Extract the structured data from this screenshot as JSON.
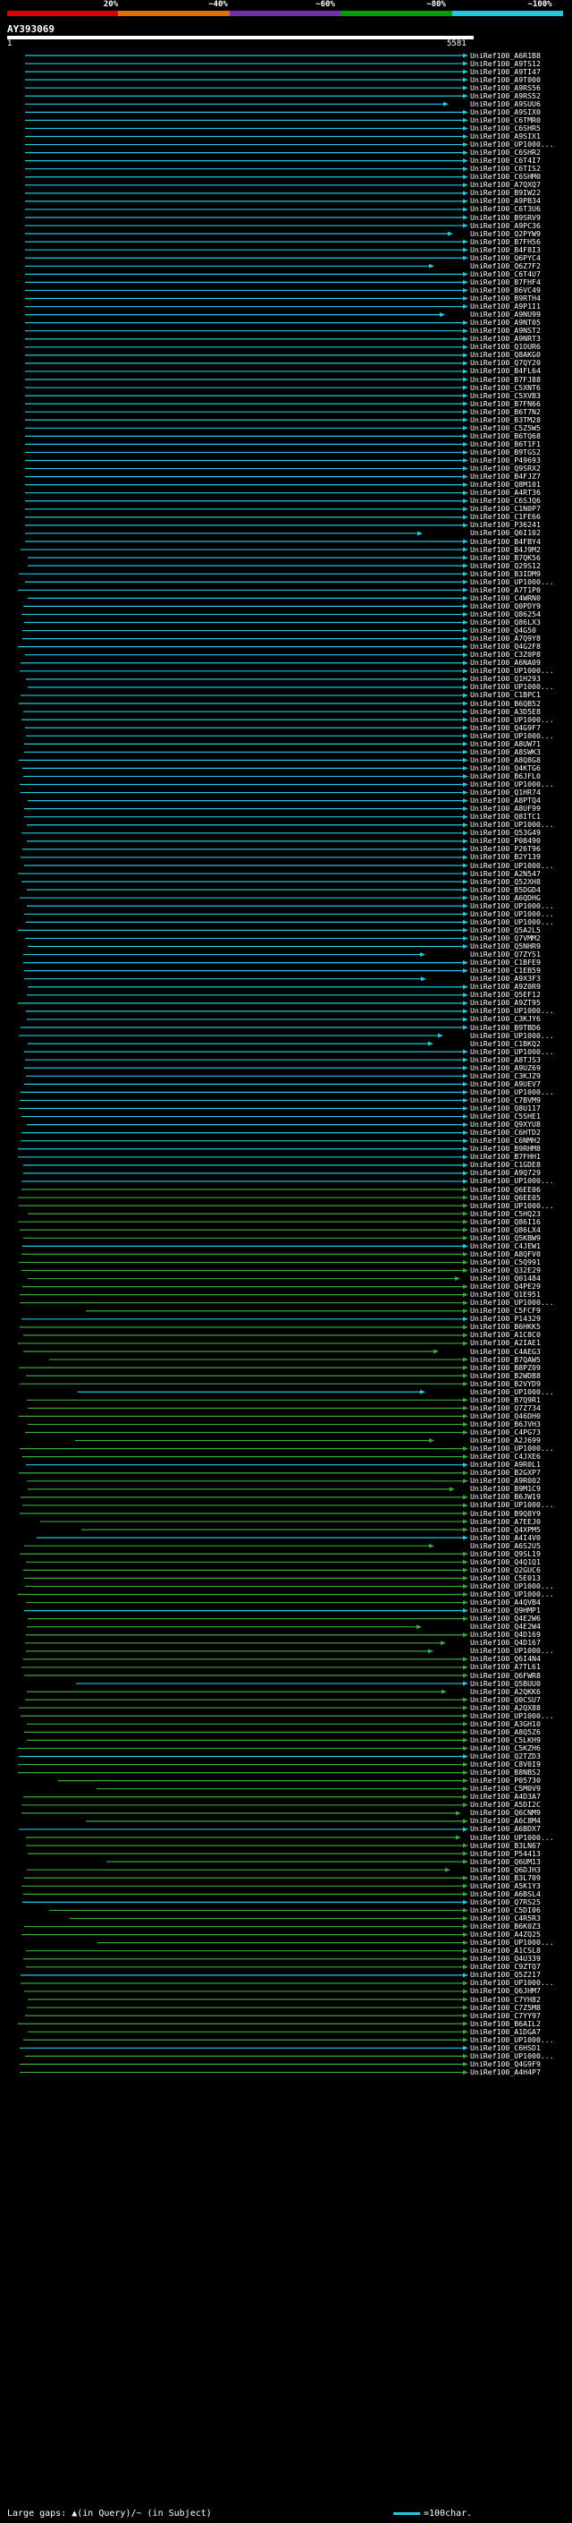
{
  "legend": {
    "labels": [
      "20%",
      "~40%",
      "~60%",
      "~80%",
      "~100%"
    ],
    "colors": [
      "#e00000",
      "#e07000",
      "#7030b0",
      "#00a000",
      "#22c8dc"
    ]
  },
  "query": {
    "name": "AY393069",
    "start": "1",
    "end": "5581"
  },
  "colors": {
    "cyan": "#22c8dc",
    "green": "#3aa83a",
    "blue": "#3c78ff",
    "white": "#ffffff"
  },
  "hits": [
    "UniRef100_A6R1B8",
    "UniRef100_A9TS12",
    "UniRef100_A9TI47",
    "UniRef100_A9T000",
    "UniRef100_A9RS56",
    "UniRef100_A9RS52",
    "UniRef100_A9SUU6",
    "UniRef100_A9SIX0",
    "UniRef100_C6TMR0",
    "UniRef100_C6SHR5",
    "UniRef100_A9SIX1",
    "UniRef100_UP1000...",
    "UniRef100_C6SHR2",
    "UniRef100_C6T4I7",
    "UniRef100_C6TIS2",
    "UniRef100_C6SHM0",
    "UniRef100_A7QXQ7",
    "UniRef100_B9IW22",
    "UniRef100_A9PB34",
    "UniRef100_C6T3U6",
    "UniRef100_B9SRV9",
    "UniRef100_A9PC36",
    "UniRef100_Q2PYW9",
    "UniRef100_B7FH56",
    "UniRef100_B4F8I3",
    "UniRef100_Q6PYC4",
    "UniRef100_Q6Z7F2",
    "UniRef100_C6T4U7",
    "UniRef100_B7FHF4",
    "UniRef100_B6VC49",
    "UniRef100_B9RTH4",
    "UniRef100_A9P1I1",
    "UniRef100_A9NU99",
    "UniRef100_A9NT05",
    "UniRef100_A9NST2",
    "UniRef100_A9NRT3",
    "UniRef100_Q1OUR6",
    "UniRef100_Q8AKG0",
    "UniRef100_Q7QY20",
    "UniRef100_B4FL64",
    "UniRef100_B7FJ88",
    "UniRef100_C5XNT6",
    "UniRef100_C5XVB3",
    "UniRef100_B7FN66",
    "UniRef100_B6T7N2",
    "UniRef100_B3TM28",
    "UniRef100_C5Z5W5",
    "UniRef100_B6TQ68",
    "UniRef100_B6T1F1",
    "UniRef100_B9TGS2",
    "UniRef100_P49693",
    "UniRef100_Q9SRX2",
    "UniRef100_B4FJZ7",
    "UniRef100_Q8M101",
    "UniRef100_A4RT36",
    "UniRef100_C6SJQ6",
    "UniRef100_C1N0P7",
    "UniRef100_C1FE66",
    "UniRef100_P36241",
    "UniRef100_Q6I102",
    "UniRef100_B4FBY4",
    "UniRef100_B4J9M2",
    "UniRef100_B7QK56",
    "UniRef100_Q29S12",
    "UniRef100_B3IDM9",
    "UniRef100_UP1000...",
    "UniRef100_A7T1P0",
    "UniRef100_C4WRN0",
    "UniRef100_Q0PDY9",
    "UniRef100_Q86254",
    "UniRef100_Q86LX3",
    "UniRef100_Q4G50",
    "UniRef100_A7Q9Y8",
    "UniRef100_Q4G2F8",
    "UniRef100_C3Z0P8",
    "UniRef100_A6NA09",
    "UniRef100_UP1000...",
    "UniRef100_Q1H293",
    "UniRef100_UP1000...",
    "UniRef100_C1BPC1",
    "UniRef100_B6QB52",
    "UniRef100_A3D5E8",
    "UniRef100_UP1000...",
    "UniRef100_Q4G9F7",
    "UniRef100_UP1000...",
    "UniRef100_A8UW71",
    "UniRef100_A8SWK3",
    "UniRef100_A8Q8G8",
    "UniRef100_Q4KTG6",
    "UniRef100_B6JFL0",
    "UniRef100_UP1000...",
    "UniRef100_Q1HR74",
    "UniRef100_A8PTQ4",
    "UniRef100_A8UF99",
    "UniRef100_Q8ITC1",
    "UniRef100_UP1000...",
    "UniRef100_Q53G49",
    "UniRef100_P08490",
    "UniRef100_P26T96",
    "UniRef100_B2Y139",
    "UniRef100_UP1000...",
    "UniRef100_A2N547",
    "UniRef100_Q52XH8",
    "UniRef100_B5DGD4",
    "UniRef100_A6QDHG",
    "UniRef100_UP1000...",
    "UniRef100_UP1000...",
    "UniRef100_UP1000...",
    "UniRef100_Q5A2L5",
    "UniRef100_Q7VMM2",
    "UniRef100_Q5NHR9",
    "UniRef100_Q7ZYS1",
    "UniRef100_C1BFE9",
    "UniRef100_C1EB59",
    "UniRef100_A9X3F3",
    "UniRef100_A9Z0R9",
    "UniRef100_Q5EF12",
    "UniRef100_A9ZT95",
    "UniRef100_UP1000...",
    "UniRef100_C3KJY6",
    "UniRef100_B9TBD6",
    "UniRef100_UP1000...",
    "UniRef100_C1BKQ2",
    "UniRef100_UP1000...",
    "UniRef100_A8TJS3",
    "UniRef100_A9UZ69",
    "UniRef100_C3KJZ9",
    "UniRef100_A9UEV7",
    "UniRef100_UP1000...",
    "UniRef100_C7BVM9",
    "UniRef100_Q8U117",
    "UniRef100_C5SHE1",
    "UniRef100_Q9XYU8",
    "UniRef100_C6HTD2",
    "UniRef100_C6NMH2",
    "UniRef100_B9RHM8",
    "UniRef100_B7FHH1",
    "UniRef100_C1GDE8",
    "UniRef100_A9Q729",
    "UniRef100_UP1000...",
    "UniRef100_Q6EE06",
    "UniRef100_Q6EE05",
    "UniRef100_UP1000...",
    "UniRef100_C5HQ23",
    "UniRef100_Q86I16",
    "UniRef100_Q86LX4",
    "UniRef100_Q5KBW9",
    "UniRef100_C4JEW1",
    "UniRef100_A8QFV0",
    "UniRef100_C5Q991",
    "UniRef100_Q32E29",
    "UniRef100_Q01484",
    "UniRef100_Q4PE29",
    "UniRef100_Q1E951",
    "UniRef100_UP1000...",
    "UniRef100_C5FCF9",
    "UniRef100_P14329",
    "UniRef100_B6HKK5",
    "UniRef100_A1C8C0",
    "UniRef100_A2IAE1",
    "UniRef100_C4AEG3",
    "UniRef100_B7QAW5",
    "UniRef100_B8PZ09",
    "UniRef100_B2WDB8",
    "UniRef100_B2VYD9",
    "UniRef100_UP1000...",
    "UniRef100_B7Q9R1",
    "UniRef100_Q7Z734",
    "UniRef100_Q46DH0",
    "UniRef100_B6JVH3",
    "UniRef100_C4PG73",
    "UniRef100_A2J699",
    "UniRef100_UP1000...",
    "UniRef100_C4JXE6",
    "UniRef100_A9R0L1",
    "UniRef100_B2GXP7",
    "UniRef100_A9R002",
    "UniRef100_B9M1C9",
    "UniRef100_B6JW19",
    "UniRef100_UP1000...",
    "UniRef100_B9Q8Y9",
    "UniRef100_A7EEJ0",
    "UniRef100_Q4XPM5",
    "UniRef100_A4I4V0",
    "UniRef100_A6S2U5",
    "UniRef100_Q9SL19",
    "UniRef100_Q4Q1Q1",
    "UniRef100_Q2GUC6",
    "UniRef100_C5E013",
    "UniRef100_UP1000...",
    "UniRef100_UP1000...",
    "UniRef100_A4QVB4",
    "UniRef100_Q9HMP1",
    "UniRef100_Q4E2W6",
    "UniRef100_Q4E2W4",
    "UniRef100_Q4D169",
    "UniRef100_Q4D167",
    "UniRef100_UP1000...",
    "UniRef100_Q6I4N4",
    "UniRef100_A7TL61",
    "UniRef100_Q6FWR8",
    "UniRef100_Q5BUU0",
    "UniRef100_A2QKK6",
    "UniRef100_Q0CSU7",
    "UniRef100_A2QX88",
    "UniRef100_UP1000...",
    "UniRef100_A3GH10",
    "UniRef100_A8Q5Z6",
    "UniRef100_C5LKH9",
    "UniRef100_C5KZH6",
    "UniRef100_Q2TZD3",
    "UniRef100_C8V0I9",
    "UniRef100_B8NBS2",
    "UniRef100_P05730",
    "UniRef100_C5M0V9",
    "UniRef100_A4D3A7",
    "UniRef100_A5DI2C",
    "UniRef100_Q6CNM9",
    "UniRef100_A6C8M4",
    "UniRef100_A6BDX7",
    "UniRef100_UP1000...",
    "UniRef100_B3LN67",
    "UniRef100_P54413",
    "UniRef100_Q6UM13",
    "UniRef100_Q6DJH3",
    "UniRef100_B3L709",
    "UniRef100_A5K1Y3",
    "UniRef100_A6BSL4",
    "UniRef100_Q7RS25",
    "UniRef100_C5DI06",
    "UniRef100_C4R5R3",
    "UniRef100_B6K0Z3",
    "UniRef100_A4ZQ25",
    "UniRef100_UP1000...",
    "UniRef100_A1CSL8",
    "UniRef100_Q4U339",
    "UniRef100_C9ZTQ7",
    "UniRef100_Q5Z217",
    "UniRef100_UP1000...",
    "UniRef100_Q6JHM7",
    "UniRef100_C7YH82",
    "UniRef100_C7Z5M8",
    "UniRef100_C7YY97",
    "UniRef100_B6AIL2",
    "UniRef100_A1DGA7",
    "UniRef100_UP1000...",
    "UniRef100_C6HSD1",
    "UniRef100_UP1000...",
    "UniRef100_Q4G9F9",
    "UniRef100_A4H4P7"
  ],
  "footer": {
    "left": "Large gaps: ▲(in Query)/~ (in Subject)",
    "right": "=100char."
  }
}
